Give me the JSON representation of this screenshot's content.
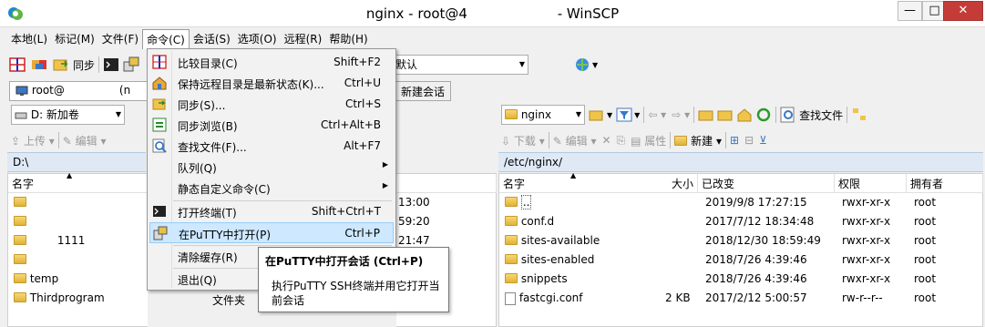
{
  "window": {
    "title_prefix": "nginx - root@4",
    "title_suffix": " - WinSCP",
    "min_glyph": "—",
    "max_glyph": "□",
    "close_glyph": "✕"
  },
  "menubar": [
    "本地(L)",
    "标记(M)",
    "文件(F)",
    "命令(C)",
    "会话(S)",
    "选项(O)",
    "远程(R)",
    "帮助(H)"
  ],
  "toolbar": {
    "sync_label": "同步",
    "transfer_setting": "默认"
  },
  "tabs": {
    "session_label": "root@",
    "session_suffix": "(n",
    "new_session": "新建会话"
  },
  "local": {
    "drive": "D: 新加卷",
    "upload": "上传",
    "edit": "编辑",
    "path": "D:\\",
    "col_name": "名字",
    "col_type": "文件夹",
    "rows": [
      {
        "name": "",
        "time": "13:00"
      },
      {
        "name": "",
        "time": "59:20"
      },
      {
        "name": "1111",
        "time": "21:47"
      },
      {
        "name": "",
        "time": ""
      },
      {
        "name": "temp",
        "time": ""
      },
      {
        "name": "Thirdprogram",
        "time": "文件夹"
      }
    ]
  },
  "remote": {
    "folder": "nginx",
    "find_files": "查找文件",
    "download": "下载",
    "edit": "编辑",
    "properties": "属性",
    "new": "新建",
    "path": "/etc/nginx/",
    "columns": {
      "name": "名字",
      "size": "大小",
      "changed": "已改变",
      "rights": "权限",
      "owner": "拥有者"
    },
    "rows": [
      {
        "name": "..",
        "size": "",
        "changed": "2019/9/8 17:27:15",
        "rights": "rwxr-xr-x",
        "owner": "root",
        "kind": "up"
      },
      {
        "name": "conf.d",
        "size": "",
        "changed": "2017/7/12 18:34:48",
        "rights": "rwxr-xr-x",
        "owner": "root",
        "kind": "folder"
      },
      {
        "name": "sites-available",
        "size": "",
        "changed": "2018/12/30 18:59:49",
        "rights": "rwxr-xr-x",
        "owner": "root",
        "kind": "folder"
      },
      {
        "name": "sites-enabled",
        "size": "",
        "changed": "2018/7/26 4:39:46",
        "rights": "rwxr-xr-x",
        "owner": "root",
        "kind": "folder"
      },
      {
        "name": "snippets",
        "size": "",
        "changed": "2018/7/26 4:39:46",
        "rights": "rwxr-xr-x",
        "owner": "root",
        "kind": "folder"
      },
      {
        "name": "fastcgi.conf",
        "size": "2 KB",
        "changed": "2017/2/12 5:00:57",
        "rights": "rw-r--r--",
        "owner": "root",
        "kind": "file"
      }
    ]
  },
  "command_menu": {
    "items": [
      {
        "label": "比较目录(C)",
        "shortcut": "Shift+F2",
        "icon": "compare-icon"
      },
      {
        "label": "保持远程目录是最新状态(K)...",
        "shortcut": "Ctrl+U",
        "icon": "keep-uptodate-icon"
      },
      {
        "label": "同步(S)...",
        "shortcut": "Ctrl+S",
        "icon": "sync-icon"
      },
      {
        "label": "同步浏览(B)",
        "shortcut": "Ctrl+Alt+B",
        "icon": "sync-browse-icon"
      },
      {
        "label": "查找文件(F)...",
        "shortcut": "Alt+F7",
        "icon": "find-icon"
      },
      {
        "label": "队列(Q)",
        "shortcut": "",
        "icon": ""
      },
      {
        "label": "静态自定义命令(C)",
        "shortcut": "",
        "icon": ""
      },
      {
        "label": "打开终端(T)",
        "shortcut": "Shift+Ctrl+T",
        "icon": "terminal-icon"
      },
      {
        "label": "在PuTTY中打开(P)",
        "shortcut": "Ctrl+P",
        "icon": "putty-icon"
      },
      {
        "label": "清除缓存(R)",
        "shortcut": "",
        "icon": ""
      },
      {
        "label": "退出(Q)",
        "shortcut": "",
        "icon": ""
      }
    ]
  },
  "tooltip": {
    "title": "在PuTTY中打开会话 (Ctrl+P)",
    "body": "执行PuTTY SSH终端并用它打开当前会话"
  },
  "colors": {
    "accent": "#cde8ff",
    "path_bar": "#dfe9f5",
    "close": "#c43b38"
  }
}
